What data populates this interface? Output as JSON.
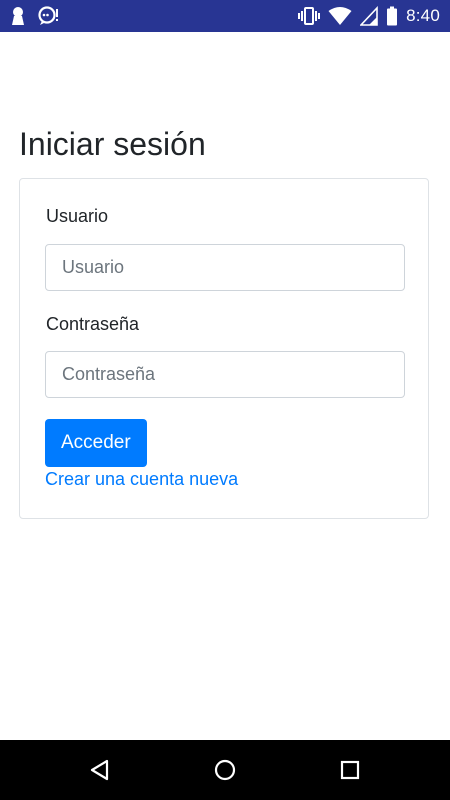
{
  "status_bar": {
    "time": "8:40",
    "left_icons": [
      "keyhole-icon",
      "chat-alert-icon"
    ],
    "right_icons": [
      "vibrate-icon",
      "wifi-icon",
      "signal-icon",
      "battery-icon"
    ],
    "background_color": "#283593"
  },
  "login": {
    "title": "Iniciar sesión",
    "username": {
      "label": "Usuario",
      "placeholder": "Usuario",
      "value": ""
    },
    "password": {
      "label": "Contraseña",
      "placeholder": "Contraseña",
      "value": ""
    },
    "submit_label": "Acceder",
    "create_account_link": "Crear una cuenta nueva"
  },
  "nav_bar": {
    "buttons": [
      "back-icon",
      "home-icon",
      "recents-icon"
    ]
  },
  "colors": {
    "accent": "#007bff",
    "text": "#212529",
    "border": "#dee2e6"
  }
}
